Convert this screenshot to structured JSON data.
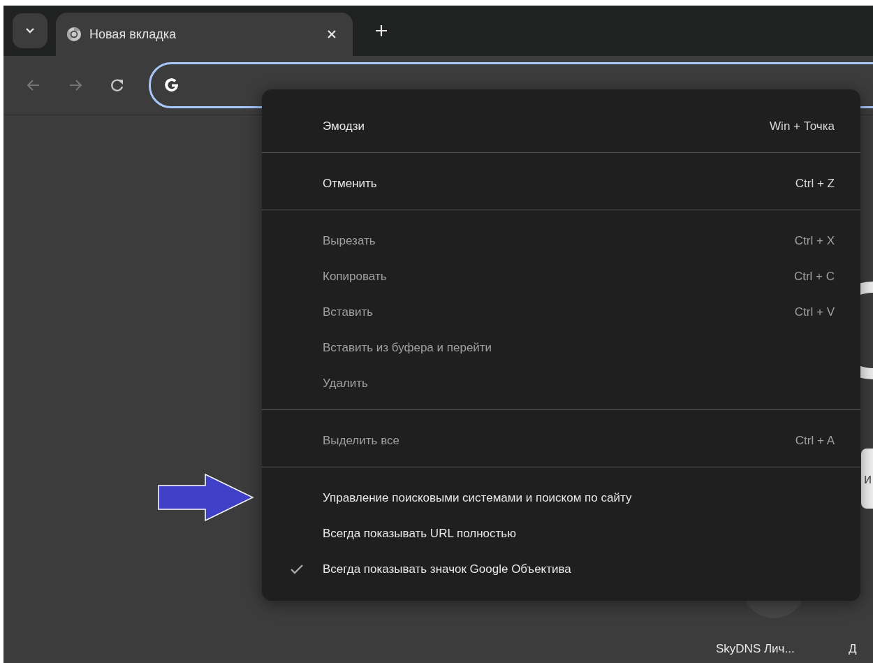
{
  "tabs": [
    {
      "title": "Новая вкладка",
      "selected": true
    }
  ],
  "new_tab_page": {
    "search_box_text": "и",
    "shortcuts": [
      {
        "title": "SkyDNS Лич..."
      },
      {
        "title": "Д"
      }
    ]
  },
  "context_menu": {
    "groups": [
      {
        "items": [
          {
            "label": "Эмодзи",
            "shortcut": "Win + Точка",
            "disabled": false,
            "checked": false
          }
        ]
      },
      {
        "items": [
          {
            "label": "Отменить",
            "shortcut": "Ctrl + Z",
            "disabled": false,
            "checked": false
          }
        ]
      },
      {
        "items": [
          {
            "label": "Вырезать",
            "shortcut": "Ctrl + X",
            "disabled": true,
            "checked": false
          },
          {
            "label": "Копировать",
            "shortcut": "Ctrl + C",
            "disabled": true,
            "checked": false
          },
          {
            "label": "Вставить",
            "shortcut": "Ctrl + V",
            "disabled": true,
            "checked": false
          },
          {
            "label": "Вставить из буфера и перейти",
            "disabled": true,
            "checked": false
          },
          {
            "label": "Удалить",
            "disabled": true,
            "checked": false
          }
        ]
      },
      {
        "items": [
          {
            "label": "Выделить все",
            "shortcut": "Ctrl + A",
            "disabled": true,
            "checked": false
          }
        ]
      },
      {
        "items": [
          {
            "label": "Управление поисковыми системами и поиском по сайту",
            "disabled": false,
            "checked": false
          },
          {
            "label": "Всегда показывать URL полностью",
            "disabled": false,
            "checked": false
          },
          {
            "label": "Всегда показывать значок Google Объектива",
            "disabled": false,
            "checked": true
          }
        ]
      }
    ]
  }
}
